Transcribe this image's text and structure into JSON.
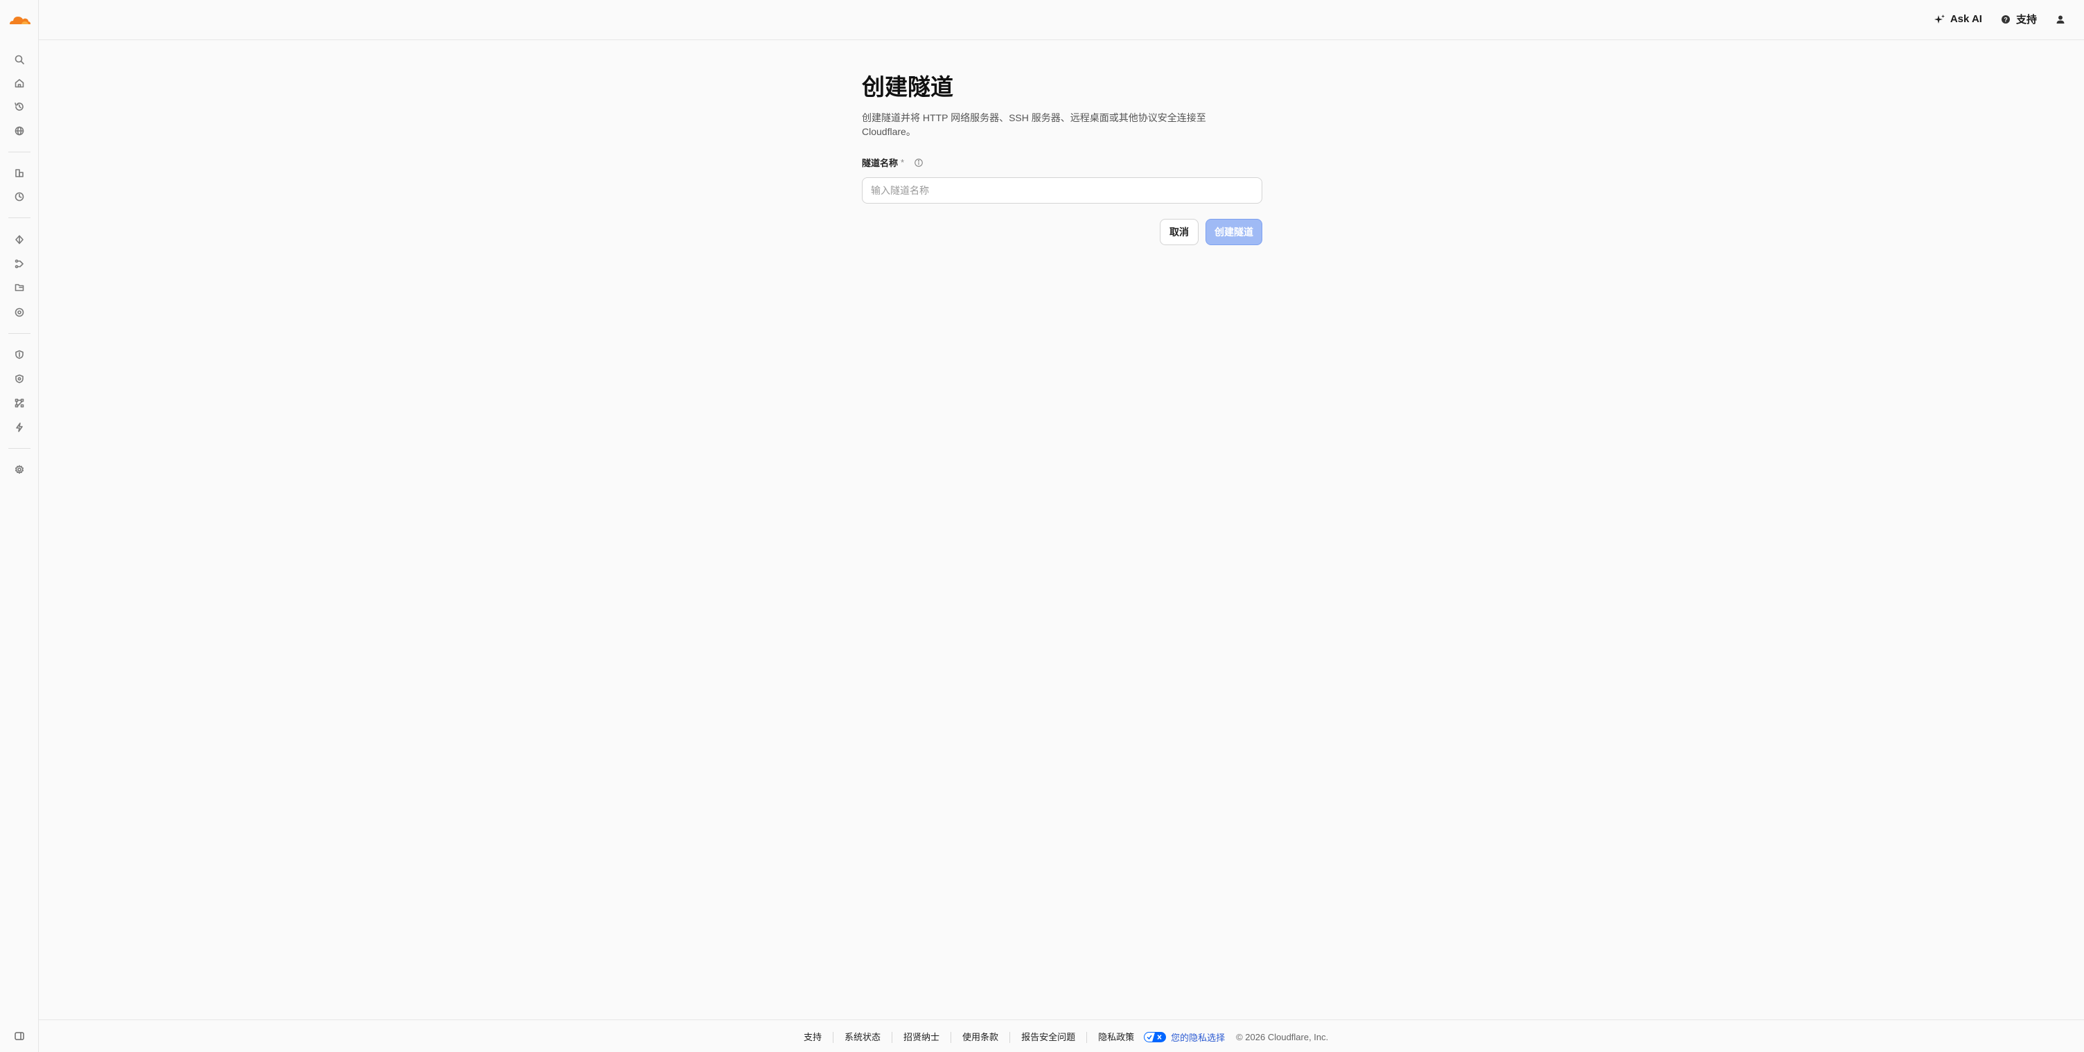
{
  "header": {
    "ask_ai_label": "Ask AI",
    "support_label": "支持"
  },
  "sidebar": {
    "icons": [
      "search-icon",
      "home-icon",
      "history-icon",
      "globe-icon",
      "chart-icon",
      "clock-icon",
      "diamond-icon",
      "tunnel-icon",
      "folder-icon",
      "eye-icon",
      "shield-icon",
      "shield-check-icon",
      "network-icon",
      "bolt-icon",
      "settings-icon"
    ]
  },
  "main": {
    "title": "创建隧道",
    "description": "创建隧道并将 HTTP 网络服务器、SSH 服务器、远程桌面或其他协议安全连接至 Cloudflare。",
    "field_label": "隧道名称",
    "required_mark": "*",
    "input_placeholder": "输入隧道名称",
    "input_value": "",
    "cancel_label": "取消",
    "create_label": "创建隧道"
  },
  "footer": {
    "links": [
      "支持",
      "系统状态",
      "招贤纳士",
      "使用条款",
      "报告安全问题",
      "隐私政策"
    ],
    "privacy_choice": "您的隐私选择",
    "copyright": "© 2026 Cloudflare, Inc."
  },
  "colors": {
    "accent": "#f38020",
    "primary_disabled": "#9fbaf5",
    "link": "#2c5bd2"
  }
}
